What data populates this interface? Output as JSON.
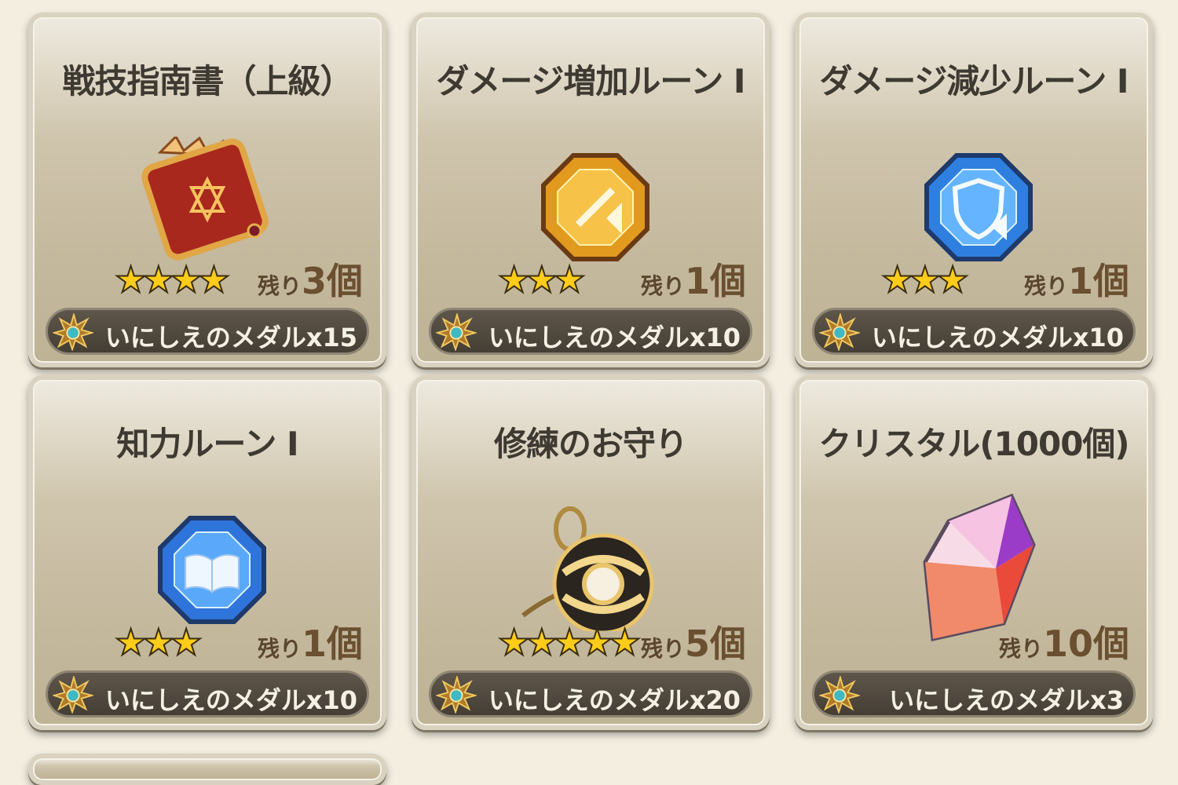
{
  "cards": [
    {
      "title": "戦技指南書（上級）",
      "stock_prefix": "残り",
      "stock_value": "3個",
      "price": "いにしえのメダルx15",
      "stars": 4,
      "icon": "skill-book-icon"
    },
    {
      "title": "ダメージ増加ルーン I",
      "stock_prefix": "残り",
      "stock_value": "1個",
      "price": "いにしえのメダルx10",
      "stars": 3,
      "icon": "damage-up-rune-icon"
    },
    {
      "title": "ダメージ減少ルーン I",
      "stock_prefix": "残り",
      "stock_value": "1個",
      "price": "いにしえのメダルx10",
      "stars": 3,
      "icon": "damage-down-rune-icon"
    },
    {
      "title": "知力ルーン I",
      "stock_prefix": "残り",
      "stock_value": "1個",
      "price": "いにしえのメダルx10",
      "stars": 3,
      "icon": "intellect-rune-icon"
    },
    {
      "title": "修練のお守り",
      "stock_prefix": "残り",
      "stock_value": "5個",
      "price": "いにしえのメダルx20",
      "stars": 5,
      "icon": "training-charm-icon"
    },
    {
      "title": "クリスタル(1000個)",
      "stock_prefix": "残り",
      "stock_value": "10個",
      "price": "いにしえのメダルx3",
      "stars": 0,
      "icon": "crystal-icon"
    }
  ],
  "star_color": "#ffcc1a"
}
